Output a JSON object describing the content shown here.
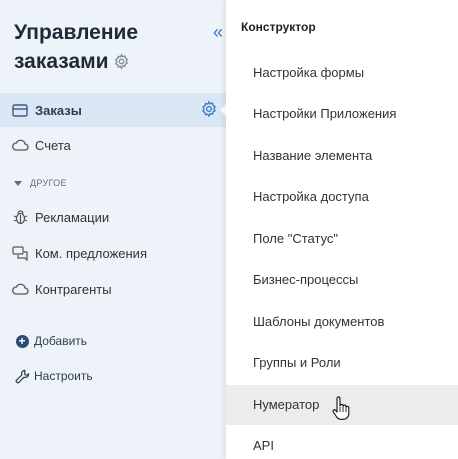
{
  "sidebar": {
    "title": "Управление заказами",
    "collapse_icon": "double-chevron-left-icon",
    "items": [
      {
        "label": "Заказы",
        "icon": "card-icon",
        "active": true
      },
      {
        "label": "Счета",
        "icon": "cloud-icon",
        "active": false
      },
      {
        "label": "Рекламации",
        "icon": "bug-icon",
        "active": false
      },
      {
        "label": "Ком. предложения",
        "icon": "chat-icon",
        "active": false
      },
      {
        "label": "Контрагенты",
        "icon": "cloud-icon",
        "active": false
      }
    ],
    "group_label": "ДРУГОЕ",
    "add_label": "Добавить",
    "configure_label": "Настроить"
  },
  "menu": {
    "header": "Конструктор",
    "items": [
      {
        "label": "Настройка формы"
      },
      {
        "label": "Настройки Приложения"
      },
      {
        "label": "Название элемента"
      },
      {
        "label": "Настройка доступа"
      },
      {
        "label": "Поле \"Статус\""
      },
      {
        "label": "Бизнес-процессы"
      },
      {
        "label": "Шаблоны документов"
      },
      {
        "label": "Группы и Роли"
      },
      {
        "label": "Нумератор",
        "hover": true
      },
      {
        "label": "API"
      }
    ]
  },
  "colors": {
    "sidebar_bg": "#eef3f9",
    "active_bg": "#d9e6f4",
    "accent": "#3d7bc8",
    "hover_bg": "#ececec"
  }
}
